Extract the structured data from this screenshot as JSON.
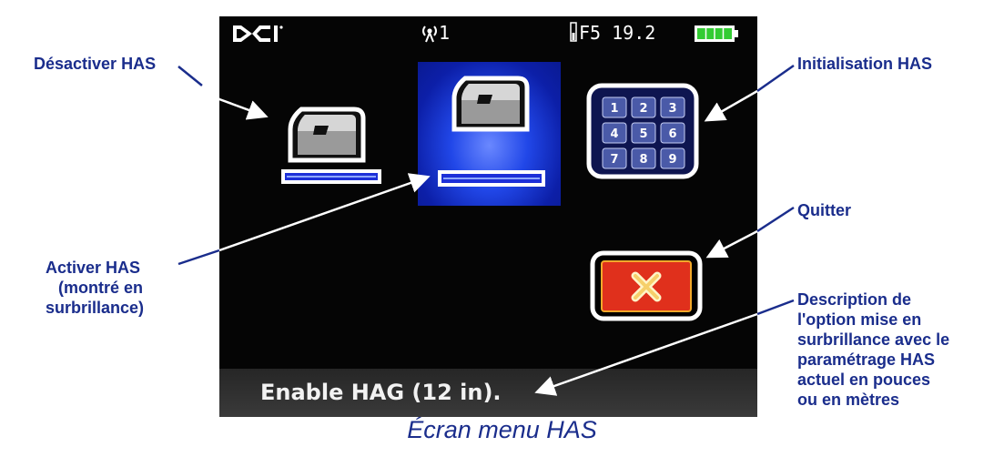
{
  "device": {
    "brand_logo": "DCI",
    "signal_channel": "1",
    "frequency": "F5 19.2",
    "battery_level": 1.0,
    "status_message": "Enable HAG (12 in)."
  },
  "menu": {
    "items": [
      {
        "id": "disable-has",
        "icon": "remote-unit-icon",
        "selected": false
      },
      {
        "id": "enable-has",
        "icon": "remote-unit-icon",
        "selected": true
      },
      {
        "id": "initialize-has",
        "icon": "keypad-icon",
        "selected": false,
        "keys": [
          "1",
          "2",
          "3",
          "4",
          "5",
          "6",
          "7",
          "8",
          "9"
        ]
      },
      {
        "id": "exit",
        "icon": "close-icon",
        "selected": false
      }
    ]
  },
  "callouts": {
    "disable": "Désactiver HAS",
    "init": "Initialisation HAS",
    "quit": "Quitter",
    "activate": [
      "Activer HAS",
      "(montré en",
      "surbrillance)"
    ],
    "description": [
      "Description de",
      "l'option mise en",
      "surbrillance avec le",
      "paramétrage HAS",
      "actuel en pouces",
      "ou en mètres"
    ]
  },
  "caption": "Écran menu HAS",
  "colors": {
    "callout_text": "#1a2d8c",
    "selection_blue": "#2147e8",
    "exit_red": "#e0301c",
    "battery_green": "#33cc33"
  }
}
